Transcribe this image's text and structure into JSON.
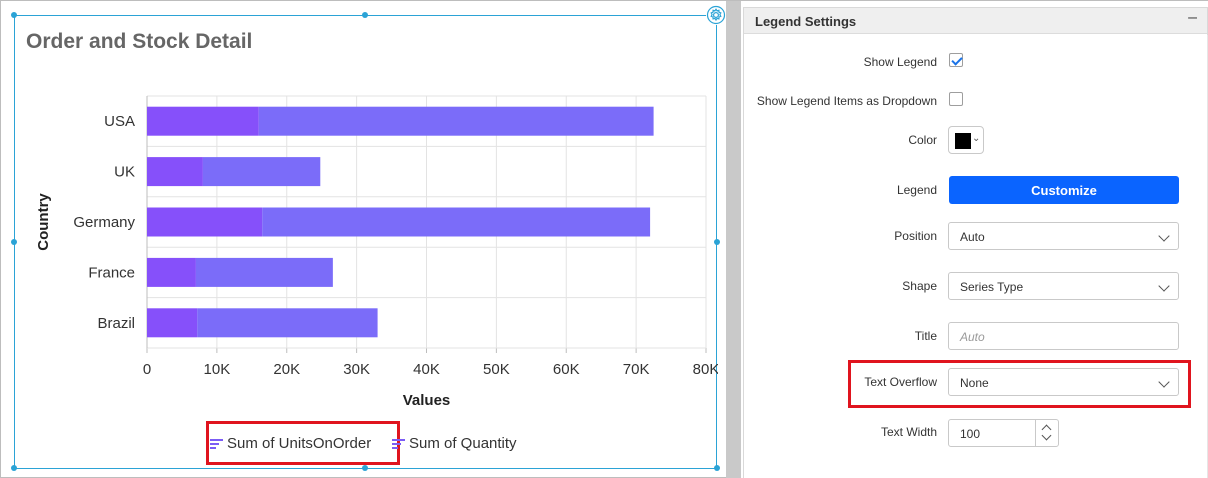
{
  "widget": {
    "title": "Order and Stock Detail"
  },
  "chart_data": {
    "type": "bar",
    "orientation": "horizontal",
    "stacked": true,
    "categories": [
      "USA",
      "UK",
      "Germany",
      "France",
      "Brazil"
    ],
    "series": [
      {
        "name": "Sum of UnitsOnOrder",
        "values": [
          16000,
          8000,
          16500,
          7000,
          7200
        ],
        "color": "#8650fa"
      },
      {
        "name": "Sum of Quantity",
        "values": [
          56500,
          16800,
          55500,
          19600,
          25800
        ],
        "color": "#7b6cf9"
      }
    ],
    "xlabel": "Values",
    "ylabel": "Country",
    "xlim": [
      0,
      80000
    ],
    "x_ticks": [
      "0",
      "10K",
      "20K",
      "30K",
      "40K",
      "50K",
      "60K",
      "70K",
      "80K"
    ],
    "grid": true,
    "legend_position": "bottom"
  },
  "panel": {
    "header_title": "Legend Settings",
    "collapse_symbol": "–",
    "show_legend_label": "Show Legend",
    "show_legend_checked": true,
    "dropdown_label": "Show Legend Items as Dropdown",
    "dropdown_checked": false,
    "color_label": "Color",
    "color_value": "#000000",
    "legend_label": "Legend",
    "customize_label": "Customize",
    "position_label": "Position",
    "position_value": "Auto",
    "shape_label": "Shape",
    "shape_value": "Series Type",
    "title_label": "Title",
    "title_placeholder": "Auto",
    "text_overflow_label": "Text Overflow",
    "text_overflow_value": "None",
    "text_width_label": "Text Width",
    "text_width_value": "100"
  },
  "colors": {
    "accent": "#0a64ff",
    "selection_border": "#2ba3d6",
    "highlight": "#e0141e"
  }
}
